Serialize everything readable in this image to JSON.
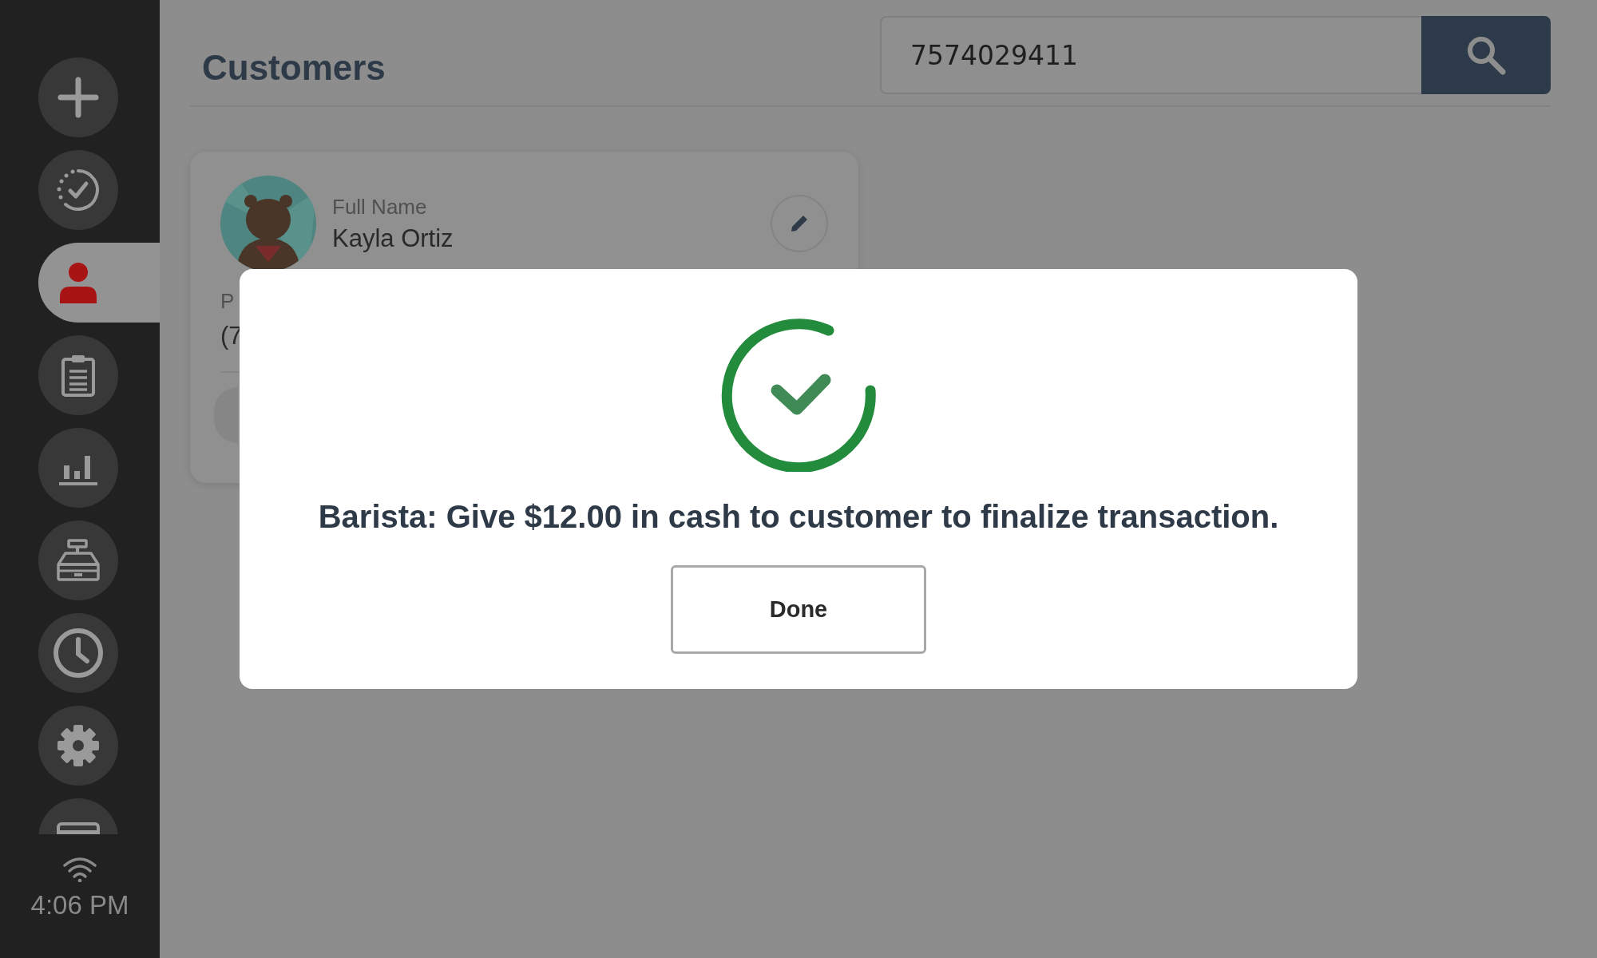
{
  "sidebar": {
    "items": [
      {
        "kind": "add",
        "selected": false
      },
      {
        "kind": "tasks",
        "selected": false
      },
      {
        "kind": "customers",
        "selected": true
      },
      {
        "kind": "orders",
        "selected": false
      },
      {
        "kind": "reports",
        "selected": false
      },
      {
        "kind": "register",
        "selected": false
      },
      {
        "kind": "clock",
        "selected": false
      },
      {
        "kind": "settings",
        "selected": false
      },
      {
        "kind": "card",
        "selected": false
      }
    ],
    "time": "4:06 PM"
  },
  "page": {
    "title": "Customers"
  },
  "search": {
    "value": "7574029411"
  },
  "customer_card": {
    "name_label": "Full Name",
    "name": "Kayla Ortiz",
    "phone_label": "P",
    "phone": "(7"
  },
  "dialog": {
    "message": "Barista: Give $12.00 in cash to customer to finalize transaction.",
    "button": "Done"
  }
}
